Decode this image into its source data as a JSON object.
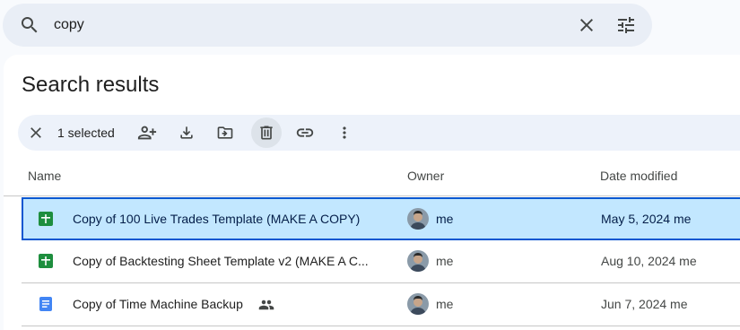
{
  "search": {
    "query": "copy"
  },
  "page": {
    "title": "Search results"
  },
  "selection_bar": {
    "count_label": "1 selected"
  },
  "table": {
    "columns": {
      "name": "Name",
      "owner": "Owner",
      "date": "Date modified"
    },
    "rows": [
      {
        "name": "Copy of 100 Live Trades Template (MAKE A COPY)",
        "type": "sheets-icon",
        "owner": "me",
        "date": "May 5, 2024 me",
        "selected": true
      },
      {
        "name": "Copy of Backtesting Sheet Template v2 (MAKE A C...",
        "type": "sheets-icon",
        "owner": "me",
        "date": "Aug 10, 2024 me",
        "selected": false
      },
      {
        "name": "Copy of Time Machine Backup",
        "type": "docs-icon",
        "owner": "me",
        "date": "Jun 7, 2024 me",
        "selected": false,
        "shared": true
      }
    ]
  },
  "colors": {
    "accent": "#0b57d0",
    "selected_row": "#c2e7ff",
    "sheets_green": "#1e8e3e",
    "docs_blue": "#4285f4"
  }
}
